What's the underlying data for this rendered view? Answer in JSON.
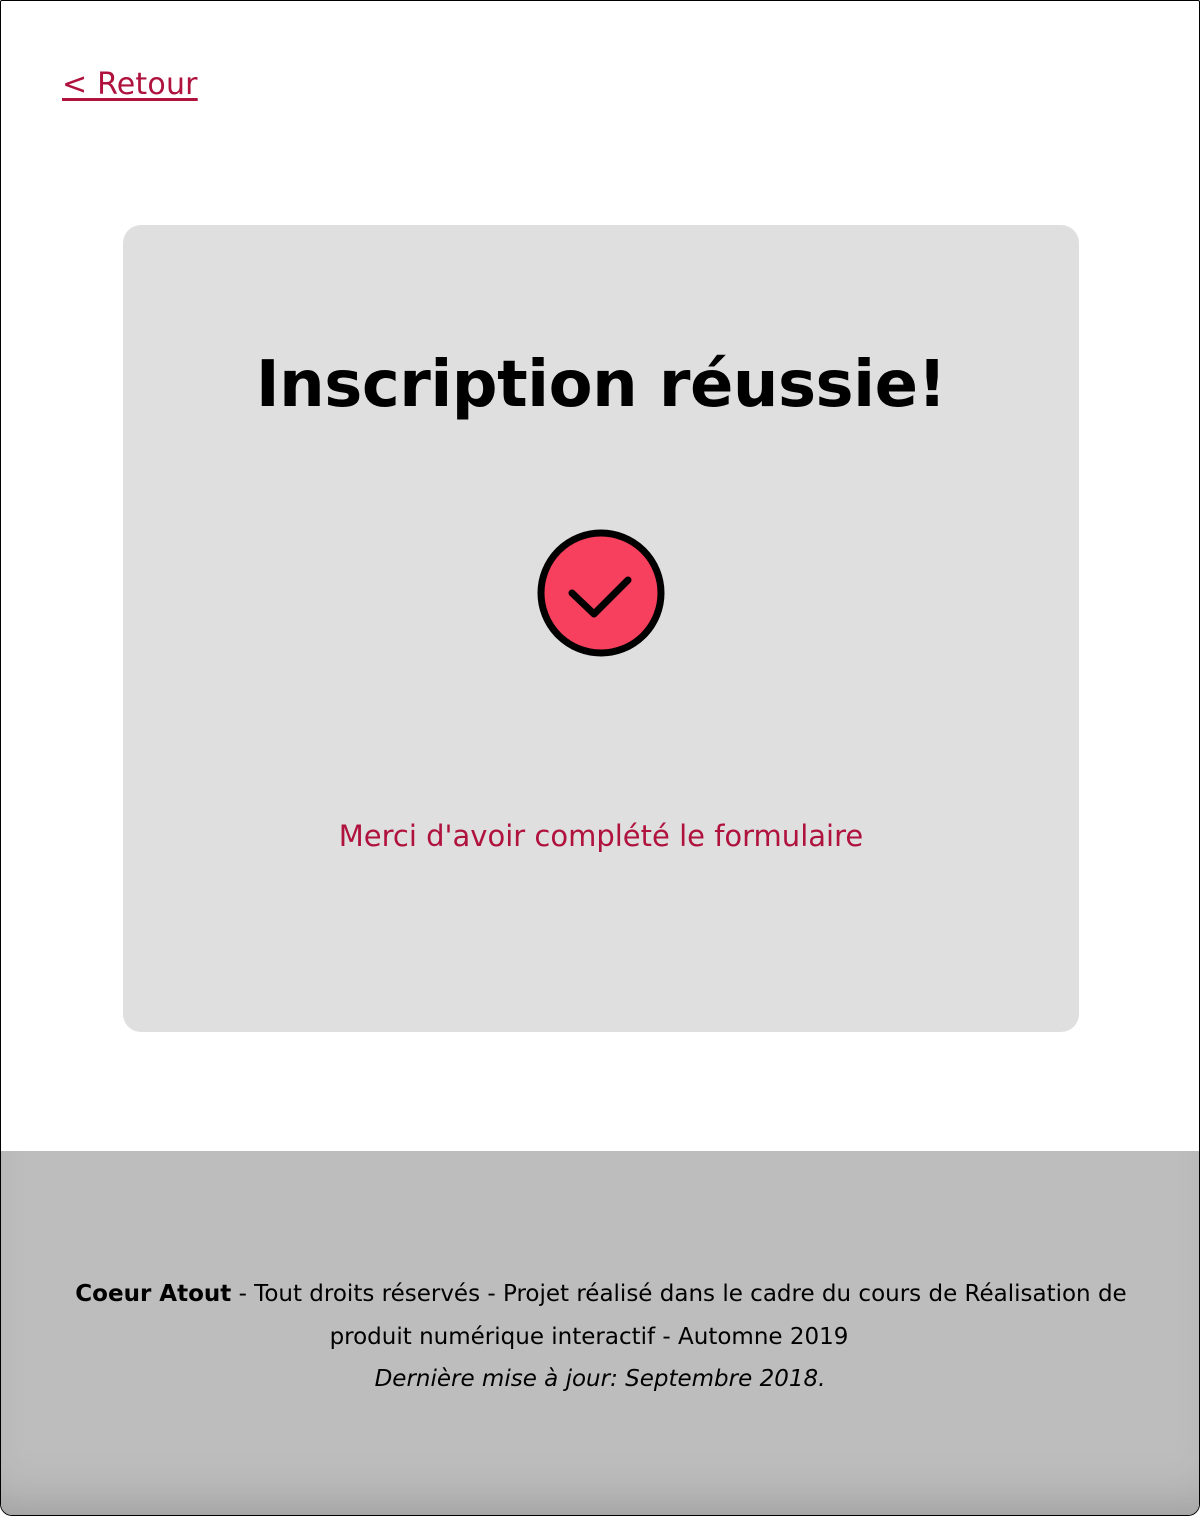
{
  "nav": {
    "back_label": "< Retour"
  },
  "card": {
    "title": "Inscription réussie!",
    "icon": "check-circle-icon",
    "message": "Merci d'avoir complété le formulaire"
  },
  "footer": {
    "brand": "Coeur Atout",
    "line1_rest": " - Tout droits réservés - Projet réalisé dans le cadre du cours de Réalisation de",
    "line2": "produit numérique interactif - Automne 2019",
    "updated": "Dernière mise à jour: Septembre 2018."
  },
  "colors": {
    "accent": "#b0123e",
    "icon_fill": "#f73f5e",
    "card_bg": "#dfdfdf",
    "footer_bg": "#bdbdbd"
  }
}
